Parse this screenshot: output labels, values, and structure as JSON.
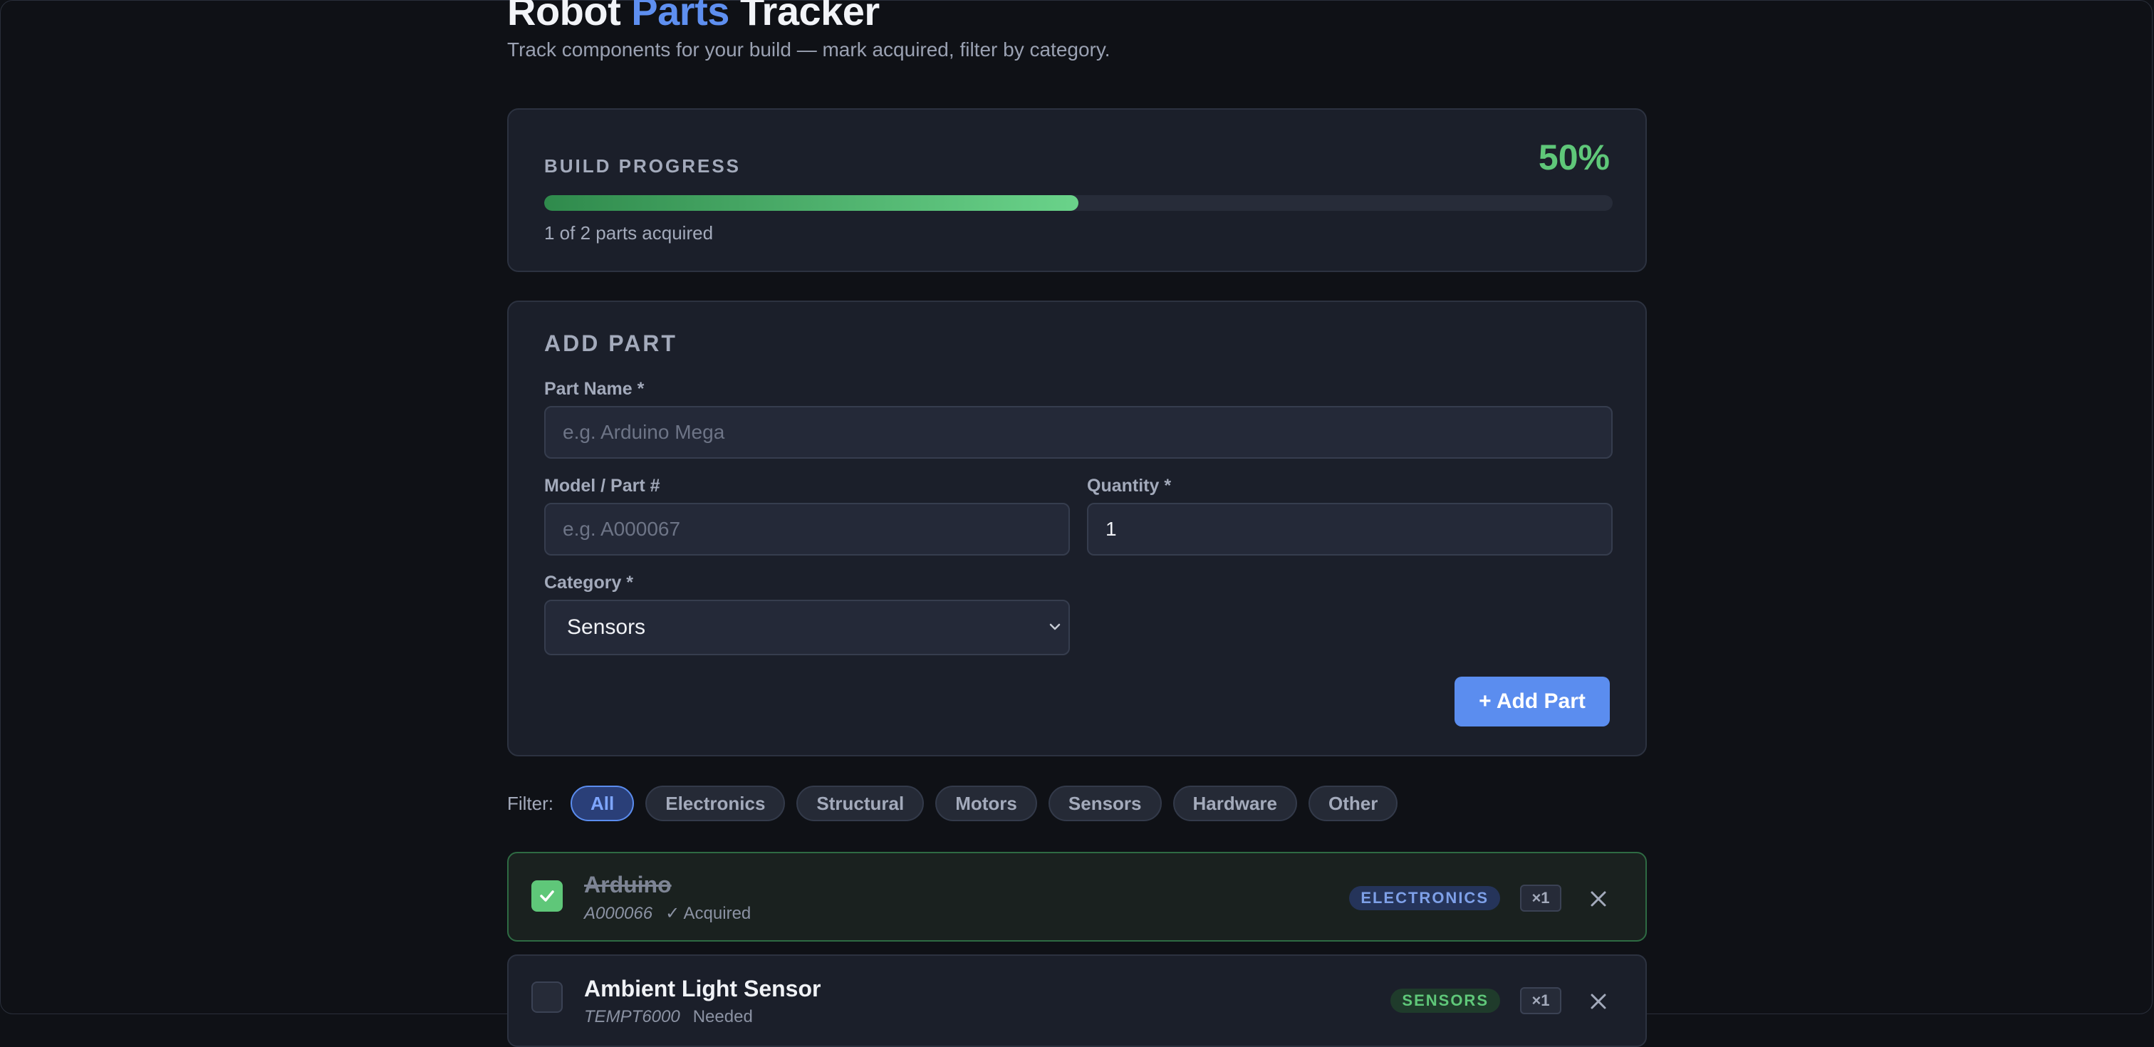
{
  "header": {
    "title_part1": "Robot",
    "title_accent": "Parts",
    "title_part2": "Tracker",
    "subtitle": "Track components for your build — mark acquired, filter by category."
  },
  "progress": {
    "label": "BUILD PROGRESS",
    "percent_text": "50%",
    "fraction": 0.5,
    "count_text": "1 of 2 parts acquired"
  },
  "add_part": {
    "title": "ADD PART",
    "name_label": "Part Name *",
    "name_placeholder": "e.g. Arduino Mega",
    "model_label": "Model / Part #",
    "model_placeholder": "e.g. A000067",
    "quantity_label": "Quantity *",
    "quantity_value": "1",
    "category_label": "Category *",
    "category_value": "Sensors",
    "submit_label": "+ Add Part"
  },
  "filter": {
    "label": "Filter:",
    "options": [
      "All",
      "Electronics",
      "Structural",
      "Motors",
      "Sensors",
      "Hardware",
      "Other"
    ],
    "active": "All"
  },
  "parts": [
    {
      "name": "Arduino",
      "model": "A000066",
      "status": "✓ Acquired",
      "category": "ELECTRONICS",
      "qty": "×1",
      "acquired": true
    },
    {
      "name": "Ambient Light Sensor",
      "model": "TEMPT6000",
      "status": "Needed",
      "category": "SENSORS",
      "qty": "×1",
      "acquired": false
    }
  ],
  "colors": {
    "accent": "#5b8def",
    "success": "#5fc779",
    "background": "#0f1116",
    "card": "#1b1f2a"
  },
  "icons": {
    "check": "check-icon",
    "close": "close-icon",
    "chevron": "chevron-down-icon"
  }
}
